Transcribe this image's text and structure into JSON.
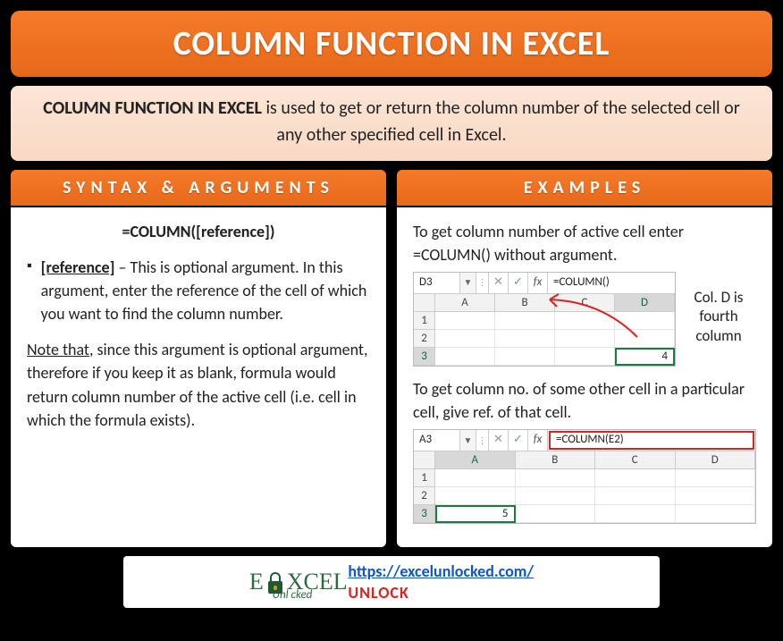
{
  "header": {
    "title": "COLUMN FUNCTION IN EXCEL"
  },
  "intro": {
    "bold_title": "COLUMN FUNCTION IN EXCEL",
    "text_rest": " is used to get or return the column number of the selected cell or any other specified cell in Excel."
  },
  "syntax": {
    "header": "SYNTAX & ARGUMENTS",
    "formula": "=COLUMN([reference])",
    "arg_name": "[reference]",
    "arg_desc": " – This is optional argument. In this argument, enter the reference of the cell of which you want to find the column number.",
    "note_prefix": "Note that",
    "note_rest": ", since this argument is optional argument, therefore if you keep it as blank, formula would return column number of the active cell (i.e. cell in which the formula exists)."
  },
  "examples": {
    "header": "EXAMPLES",
    "desc1": "To get column number of active cell enter =COLUMN() without argument.",
    "shot1": {
      "cell_ref": "D3",
      "formula": "=COLUMN()",
      "cols": [
        "A",
        "B",
        "C",
        "D"
      ],
      "rows": [
        "1",
        "2",
        "3"
      ],
      "active_col": "D",
      "active_row": "3",
      "value": "4",
      "note": "Col. D is fourth column"
    },
    "desc2": "To get column no. of some other cell in a particular cell, give ref. of that cell.",
    "shot2": {
      "cell_ref": "A3",
      "formula": "=COLUMN(E2)",
      "cols": [
        "A",
        "B",
        "C",
        "D"
      ],
      "rows": [
        "1",
        "2",
        "3"
      ],
      "active_col": "A",
      "active_row": "3",
      "value": "5"
    }
  },
  "footer": {
    "logo_part1": "E",
    "logo_part2": "XCEL",
    "logo_sub": "Unl   cked",
    "link": "https://excelunlocked.com/",
    "unlock": "UNLOCK"
  }
}
